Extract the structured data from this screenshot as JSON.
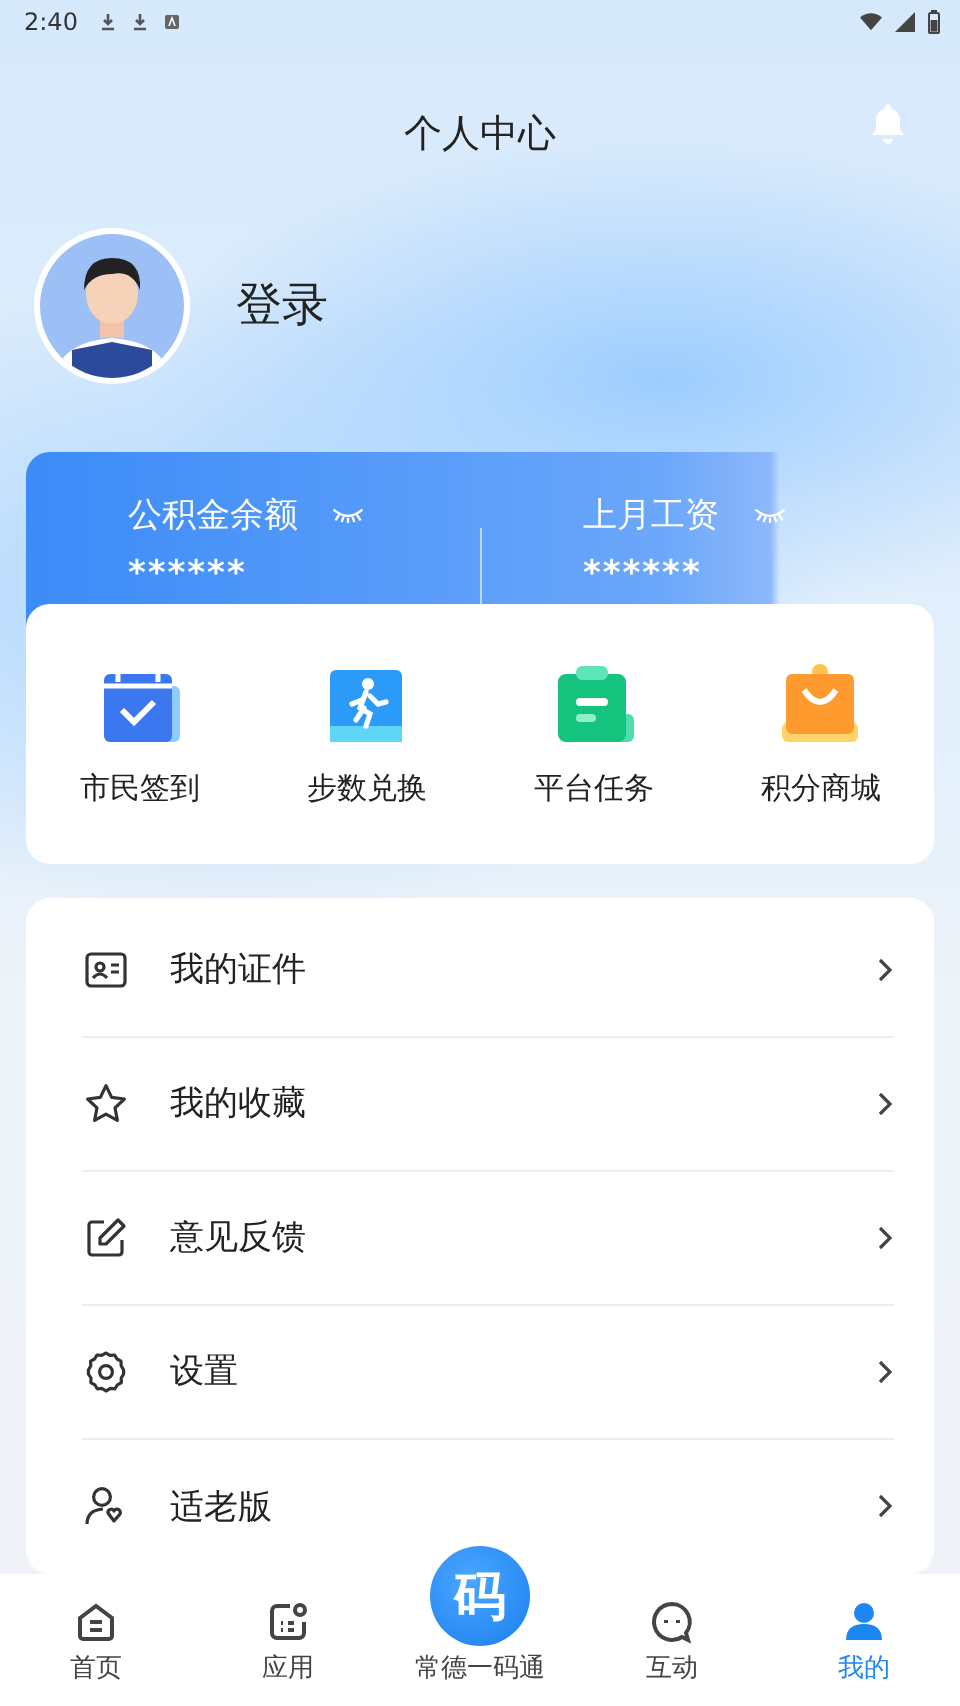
{
  "status_bar": {
    "time": "2:40"
  },
  "header": {
    "title": "个人中心"
  },
  "profile": {
    "name": "登录"
  },
  "balances": [
    {
      "label": "公积金余额",
      "value": "******"
    },
    {
      "label": "上月工资",
      "value": "******"
    }
  ],
  "shortcuts": [
    {
      "label": "市民签到",
      "kind": "calendar"
    },
    {
      "label": "步数兑换",
      "kind": "steps"
    },
    {
      "label": "平台任务",
      "kind": "clipboard"
    },
    {
      "label": "积分商城",
      "kind": "bag"
    }
  ],
  "menu": [
    {
      "label": "我的证件",
      "kind": "card"
    },
    {
      "label": "我的收藏",
      "kind": "star"
    },
    {
      "label": "意见反馈",
      "kind": "edit"
    },
    {
      "label": "设置",
      "kind": "gear"
    },
    {
      "label": "适老版",
      "kind": "elder"
    }
  ],
  "bottom_nav": [
    {
      "label": "首页",
      "kind": "home",
      "selected": false
    },
    {
      "label": "应用",
      "kind": "apps",
      "selected": false
    },
    {
      "label": "常德一码通",
      "kind": "code",
      "glyph": "码",
      "selected": false
    },
    {
      "label": "互动",
      "kind": "chat",
      "selected": false
    },
    {
      "label": "我的",
      "kind": "me",
      "selected": true
    }
  ]
}
